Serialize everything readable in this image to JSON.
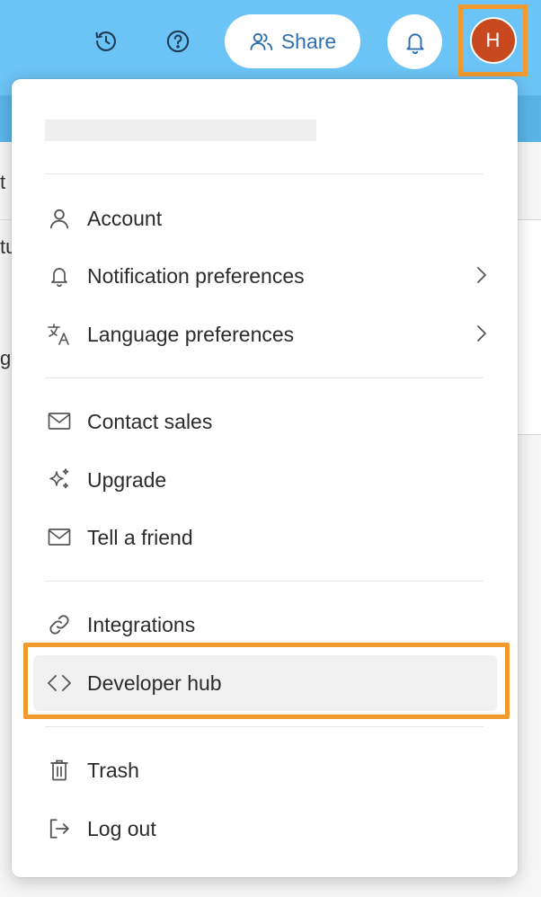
{
  "topbar": {
    "history_icon": "history-icon",
    "help_icon": "help-icon",
    "share_label": "Share",
    "share_icon": "people-icon",
    "bell_icon": "bell-icon",
    "avatar_initial": "H"
  },
  "background": {
    "fragment_1": "t",
    "fragment_2": "tu",
    "fragment_3": "g"
  },
  "menu": {
    "sections": [
      [
        {
          "label": "Account",
          "icon": "user-icon",
          "submenu": false
        },
        {
          "label": "Notification preferences",
          "icon": "bell-icon",
          "submenu": true
        },
        {
          "label": "Language preferences",
          "icon": "translate-icon",
          "submenu": true
        }
      ],
      [
        {
          "label": "Contact sales",
          "icon": "mail-icon",
          "submenu": false
        },
        {
          "label": "Upgrade",
          "icon": "sparkle-icon",
          "submenu": false
        },
        {
          "label": "Tell a friend",
          "icon": "mail-icon",
          "submenu": false
        }
      ],
      [
        {
          "label": "Integrations",
          "icon": "link-icon",
          "submenu": false
        },
        {
          "label": "Developer hub",
          "icon": "code-icon",
          "submenu": false,
          "highlighted": true
        }
      ],
      [
        {
          "label": "Trash",
          "icon": "trash-icon",
          "submenu": false
        },
        {
          "label": "Log out",
          "icon": "logout-icon",
          "submenu": false
        }
      ]
    ]
  },
  "colors": {
    "topbar": "#6cc3f5",
    "accent_blue": "#2f6fb0",
    "avatar": "#c8491f",
    "highlight_frame": "#f09a2f"
  }
}
